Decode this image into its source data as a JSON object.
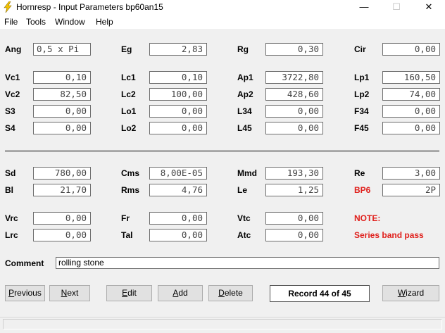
{
  "window": {
    "title": "Hornresp - Input Parameters   bp60an15",
    "minimize": "—",
    "maximize": "☐",
    "close": "✕"
  },
  "menu": [
    "File",
    "Tools",
    "Window",
    "Help"
  ],
  "params": {
    "ang": {
      "label": "Ang",
      "value": "0,5 x Pi"
    },
    "eg": {
      "label": "Eg",
      "value": "2,83"
    },
    "rg": {
      "label": "Rg",
      "value": "0,30"
    },
    "cir": {
      "label": "Cir",
      "value": "0,00"
    },
    "vc1": {
      "label": "Vc1",
      "value": "0,10"
    },
    "lc1": {
      "label": "Lc1",
      "value": "0,10"
    },
    "ap1": {
      "label": "Ap1",
      "value": "3722,80"
    },
    "lp1": {
      "label": "Lp1",
      "value": "160,50"
    },
    "vc2": {
      "label": "Vc2",
      "value": "82,50"
    },
    "lc2": {
      "label": "Lc2",
      "value": "100,00"
    },
    "ap2": {
      "label": "Ap2",
      "value": "428,60"
    },
    "lp2": {
      "label": "Lp2",
      "value": "74,00"
    },
    "s3": {
      "label": "S3",
      "value": "0,00"
    },
    "lo1": {
      "label": "Lo1",
      "value": "0,00"
    },
    "l34": {
      "label": "L34",
      "value": "0,00"
    },
    "f34": {
      "label": "F34",
      "value": "0,00"
    },
    "s4": {
      "label": "S4",
      "value": "0,00"
    },
    "lo2": {
      "label": "Lo2",
      "value": "0,00"
    },
    "l45": {
      "label": "L45",
      "value": "0,00"
    },
    "f45": {
      "label": "F45",
      "value": "0,00"
    },
    "sd": {
      "label": "Sd",
      "value": "780,00"
    },
    "cms": {
      "label": "Cms",
      "value": "8,00E-05"
    },
    "mmd": {
      "label": "Mmd",
      "value": "193,30"
    },
    "re": {
      "label": "Re",
      "value": "3,00"
    },
    "bl": {
      "label": "Bl",
      "value": "21,70"
    },
    "rms": {
      "label": "Rms",
      "value": "4,76"
    },
    "le": {
      "label": "Le",
      "value": "1,25"
    },
    "bp6": {
      "label": "BP6",
      "value": "2P"
    },
    "vrc": {
      "label": "Vrc",
      "value": "0,00"
    },
    "fr": {
      "label": "Fr",
      "value": "0,00"
    },
    "vtc": {
      "label": "Vtc",
      "value": "0,00"
    },
    "lrc": {
      "label": "Lrc",
      "value": "0,00"
    },
    "tal": {
      "label": "Tal",
      "value": "0,00"
    },
    "atc": {
      "label": "Atc",
      "value": "0,00"
    }
  },
  "note": {
    "label": "NOTE:",
    "text": "Series band pass"
  },
  "comment": {
    "label": "Comment",
    "value": "rolling stone"
  },
  "buttons": {
    "previous": {
      "pre": "",
      "ul": "P",
      "post": "revious"
    },
    "next": {
      "pre": "",
      "ul": "N",
      "post": "ext"
    },
    "edit": {
      "pre": "",
      "ul": "E",
      "post": "dit"
    },
    "add": {
      "pre": "",
      "ul": "A",
      "post": "dd"
    },
    "delete": {
      "pre": "",
      "ul": "D",
      "post": "elete"
    },
    "wizard": {
      "pre": "",
      "ul": "W",
      "post": "izard"
    }
  },
  "record": "Record 44 of 45",
  "colors": {
    "note": "#e0201c",
    "app_icon": "#f5c400"
  }
}
